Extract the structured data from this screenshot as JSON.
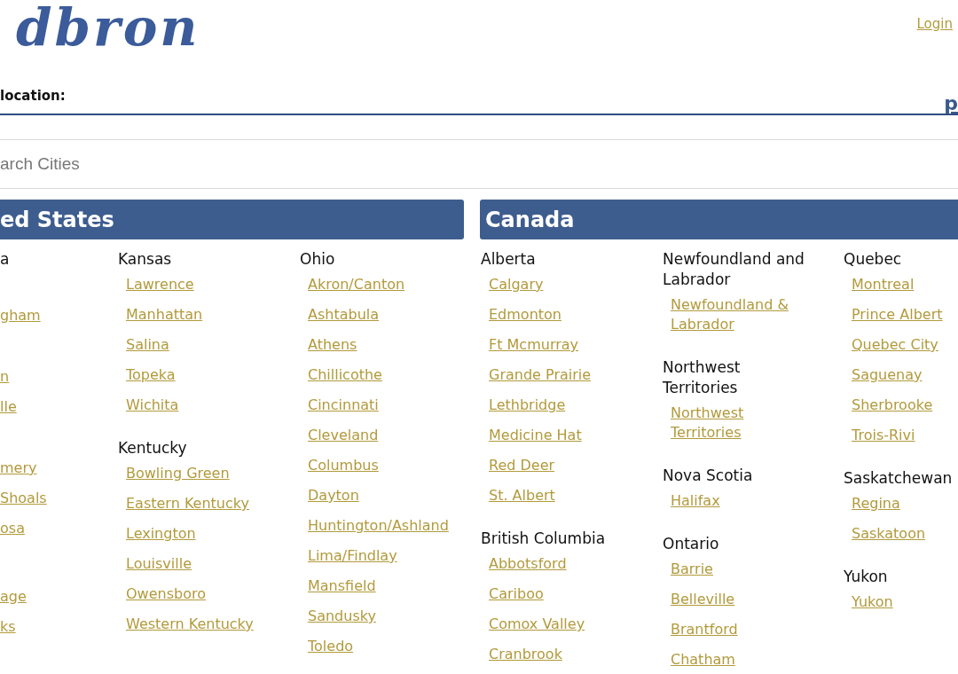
{
  "header": {
    "logo": "dbron",
    "login_link": "Login"
  },
  "location_bar": {
    "label": "location:",
    "link": "p"
  },
  "search": {
    "placeholder": "arch Cities"
  },
  "regions": [
    {
      "title": "ed States",
      "columns": [
        [
          {
            "heading": "a",
            "cities": [
              {
                "name": "gham"
              },
              {
                "name": "n"
              },
              {
                "name": "lle"
              },
              {
                "name": "mery"
              },
              {
                "name": "Shoals"
              },
              {
                "name": "osa"
              }
            ]
          },
          {
            "cities": [
              {
                "name": "age"
              },
              {
                "name": "ks"
              }
            ]
          }
        ],
        [
          {
            "heading": "Kansas",
            "cities": [
              {
                "name": "Lawrence"
              },
              {
                "name": "Manhattan"
              },
              {
                "name": "Salina"
              },
              {
                "name": "Topeka"
              },
              {
                "name": "Wichita"
              }
            ]
          },
          {
            "heading": "Kentucky",
            "cities": [
              {
                "name": "Bowling Green"
              },
              {
                "name": "Eastern Kentucky"
              },
              {
                "name": "Lexington"
              },
              {
                "name": "Louisville"
              },
              {
                "name": "Owensboro"
              },
              {
                "name": "Western Kentucky"
              }
            ]
          }
        ],
        [
          {
            "heading": "Ohio",
            "cities": [
              {
                "name": "Akron/Canton"
              },
              {
                "name": "Ashtabula"
              },
              {
                "name": "Athens"
              },
              {
                "name": "Chillicothe"
              },
              {
                "name": "Cincinnati"
              },
              {
                "name": "Cleveland"
              },
              {
                "name": "Columbus"
              },
              {
                "name": "Dayton"
              },
              {
                "name": "Huntington/Ashland"
              },
              {
                "name": "Lima/Findlay"
              },
              {
                "name": "Mansfield"
              },
              {
                "name": "Sandusky"
              },
              {
                "name": "Toledo"
              }
            ]
          }
        ]
      ]
    },
    {
      "title": "Canada",
      "columns": [
        [
          {
            "heading": "Alberta",
            "cities": [
              {
                "name": "Calgary"
              },
              {
                "name": "Edmonton"
              },
              {
                "name": "Ft Mcmurray"
              },
              {
                "name": "Grande Prairie"
              },
              {
                "name": "Lethbridge"
              },
              {
                "name": "Medicine Hat"
              },
              {
                "name": "Red Deer"
              },
              {
                "name": "St. Albert"
              }
            ]
          },
          {
            "heading": "British Columbia",
            "cities": [
              {
                "name": "Abbotsford"
              },
              {
                "name": "Cariboo"
              },
              {
                "name": "Comox Valley"
              },
              {
                "name": "Cranbrook"
              }
            ]
          }
        ],
        [
          {
            "heading": "Newfoundland and Labrador",
            "cities": [
              {
                "name": "Newfoundland & Labrador"
              }
            ]
          },
          {
            "heading": "Northwest Territories",
            "cities": [
              {
                "name": "Northwest Territories"
              }
            ]
          },
          {
            "heading": "Nova Scotia",
            "cities": [
              {
                "name": "Halifax"
              }
            ]
          },
          {
            "heading": "Ontario",
            "cities": [
              {
                "name": "Barrie"
              },
              {
                "name": "Belleville"
              },
              {
                "name": "Brantford"
              },
              {
                "name": "Chatham"
              }
            ]
          }
        ],
        [
          {
            "heading": "Quebec",
            "cities": [
              {
                "name": "Montreal"
              },
              {
                "name": "Prince Albert"
              },
              {
                "name": "Quebec City"
              },
              {
                "name": "Saguenay"
              },
              {
                "name": "Sherbrooke"
              },
              {
                "name": "Trois-Rivi"
              }
            ]
          },
          {
            "heading": "Saskatchewan",
            "cities": [
              {
                "name": "Regina"
              },
              {
                "name": "Saskatoon"
              }
            ]
          },
          {
            "heading": "Yukon",
            "cities": [
              {
                "name": "Yukon"
              }
            ]
          }
        ]
      ]
    }
  ]
}
